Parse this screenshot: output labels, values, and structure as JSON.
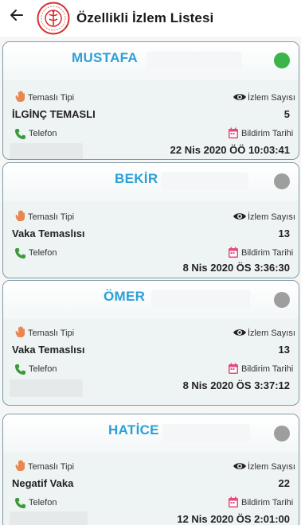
{
  "header": {
    "title": "Özellikli İzlem Listesi"
  },
  "labels": {
    "contact_type": "Temaslı Tipi",
    "follow_count": "İzlem Sayısı",
    "phone": "Telefon",
    "report_date": "Bildirim Tarihi"
  },
  "colors": {
    "accent_name": "#2aa0d8",
    "status_active": "#3bb54a",
    "status_inactive": "#9e9e9e",
    "hand_icon": "#e8874e",
    "phone_icon": "#3a9a3a",
    "calendar_icon": "#e84a7a"
  },
  "cards": [
    {
      "name": "MUSTAFA",
      "status": "active",
      "contact_type": "İLGİNÇ TEMASLI",
      "follow_count": "5",
      "report_date": "22 Nis 2020 ÖÖ 10:03:41"
    },
    {
      "name": "BEKİR",
      "status": "inactive",
      "contact_type": "Vaka Temaslısı",
      "follow_count": "13",
      "report_date": "8 Nis 2020 ÖS 3:36:30"
    },
    {
      "name": "ÖMER",
      "status": "inactive",
      "contact_type": "Vaka Temaslısı",
      "follow_count": "13",
      "report_date": "8 Nis 2020 ÖS 3:37:12"
    },
    {
      "name": "HATİCE",
      "status": "inactive",
      "contact_type": "Negatif Vaka",
      "follow_count": "22",
      "report_date": "12 Nis 2020 ÖS 2:01:00"
    }
  ]
}
